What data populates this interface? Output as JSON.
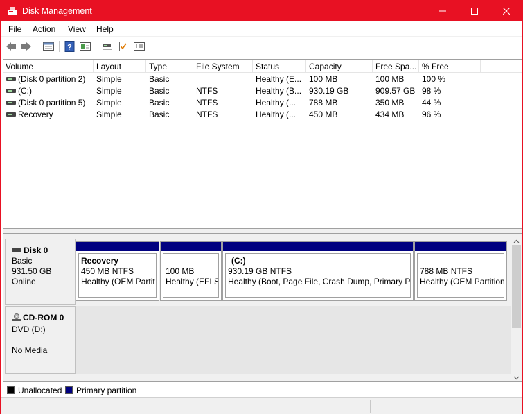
{
  "window": {
    "title": "Disk Management"
  },
  "menu": [
    "File",
    "Action",
    "View",
    "Help"
  ],
  "volume_list": {
    "columns": [
      "Volume",
      "Layout",
      "Type",
      "File System",
      "Status",
      "Capacity",
      "Free Spa...",
      "% Free"
    ],
    "rows": [
      [
        "(Disk 0 partition 2)",
        "Simple",
        "Basic",
        "",
        "Healthy (E...",
        "100 MB",
        "100 MB",
        "100 %"
      ],
      [
        "(C:)",
        "Simple",
        "Basic",
        "NTFS",
        "Healthy (B...",
        "930.19 GB",
        "909.57 GB",
        "98 %"
      ],
      [
        "(Disk 0 partition 5)",
        "Simple",
        "Basic",
        "NTFS",
        "Healthy (...",
        "788 MB",
        "350 MB",
        "44 %"
      ],
      [
        "Recovery",
        "Simple",
        "Basic",
        "NTFS",
        "Healthy (...",
        "450 MB",
        "434 MB",
        "96 %"
      ]
    ]
  },
  "disks": [
    {
      "name": "Disk 0",
      "type": "Basic",
      "size": "931.50 GB",
      "state": "Online",
      "partitions": [
        {
          "name": "Recovery",
          "size_fs": "450 MB NTFS",
          "status": "Healthy (OEM Partit"
        },
        {
          "name": "",
          "size_fs": "100 MB",
          "status": "Healthy (EFI Sy"
        },
        {
          "name": "(C:)",
          "size_fs": "930.19 GB NTFS",
          "status": "Healthy (Boot, Page File, Crash Dump, Primary Pa"
        },
        {
          "name": "",
          "size_fs": "788 MB NTFS",
          "status": "Healthy (OEM Partition"
        }
      ]
    }
  ],
  "cdrom": {
    "name": "CD-ROM 0",
    "drive": "DVD (D:)",
    "media": "No Media"
  },
  "legend": [
    {
      "label": "Unallocated",
      "color": "#000000"
    },
    {
      "label": "Primary partition",
      "color": "#000080"
    }
  ],
  "colors": {
    "titlebar": "#e81123",
    "partition_bar": "#000080"
  },
  "icons": [
    "back-icon",
    "forward-icon",
    "properties-icon",
    "help-icon",
    "view-icon",
    "connect-icon",
    "check-icon",
    "list-icon",
    "disk-icon",
    "cdrom-icon"
  ]
}
